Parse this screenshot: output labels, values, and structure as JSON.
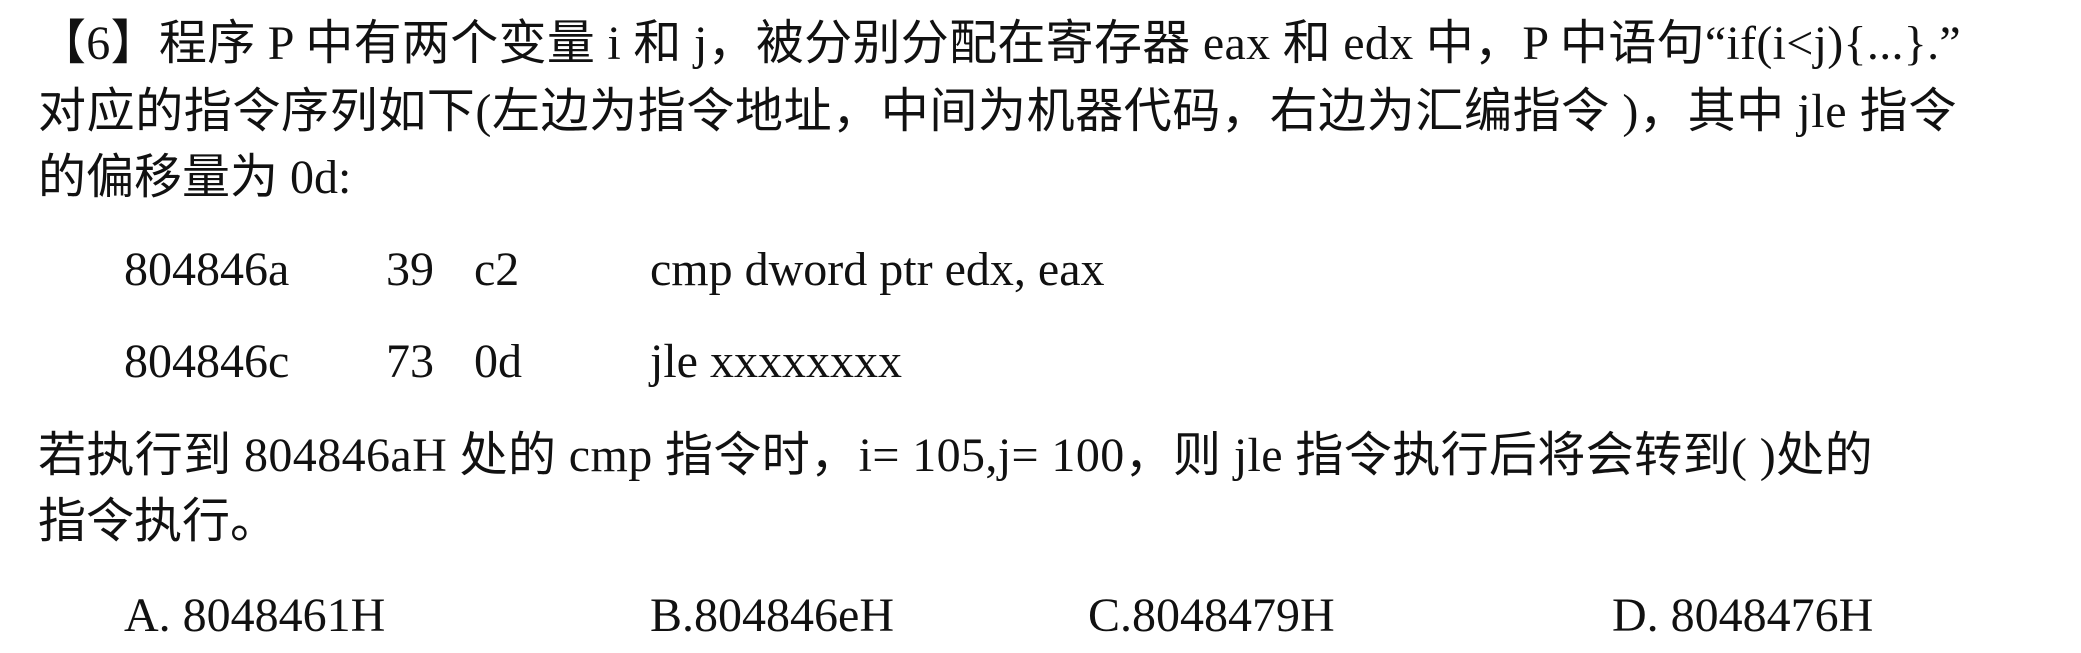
{
  "question": {
    "line1": "【6】程序 P 中有两个变量 i 和 j，被分别分配在寄存器  eax 和  edx  中，P 中语句“if(i<j){...}.”",
    "line2": "对应的指令序列如下(左边为指令地址，中间为机器代码，右边为汇编指令  )，其中  jle  指令",
    "line3": "的偏移量为  0d:"
  },
  "code": [
    {
      "address": "804846a",
      "byte1": "39",
      "byte2": "c2",
      "asm": "cmp dword ptr edx, eax"
    },
    {
      "address": "804846c",
      "byte1": "73",
      "byte2": "0d",
      "asm": "jle xxxxxxxx"
    }
  ],
  "question2": {
    "line1": "若执行到  804846aH 处的  cmp  指令时，i= 105,j= 100，则 jle  指令执行后将会转到(      )处的",
    "line2": "指令执行。"
  },
  "options": {
    "a": "A. 8048461H",
    "b": "B.804846eH",
    "c": "C.8048479H",
    "d": "D. 8048476H"
  }
}
